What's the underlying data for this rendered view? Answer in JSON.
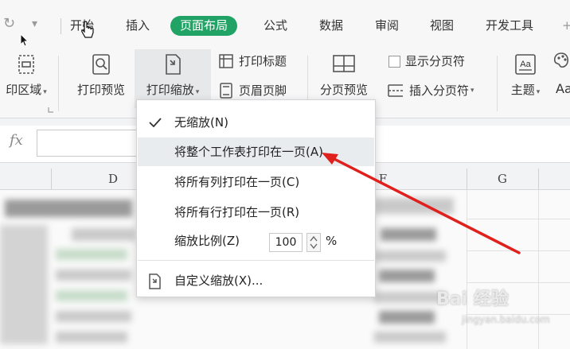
{
  "menu_tabs": [
    {
      "label": "开始"
    },
    {
      "label": "插入"
    },
    {
      "label": "页面布局",
      "active": true
    },
    {
      "label": "公式"
    },
    {
      "label": "数据"
    },
    {
      "label": "审阅"
    },
    {
      "label": "视图"
    },
    {
      "label": "开发工具"
    }
  ],
  "accent_color": "#22a366",
  "arrow_color": "#e0201c",
  "ribbon": {
    "print_area": "印区域",
    "print_preview": "打印预览",
    "print_scale": "打印缩放",
    "print_titles": "打印标题",
    "header_footer": "页眉页脚",
    "page_break_preview": "分页预览",
    "show_page_breaks": "显示分页符",
    "insert_page_break": "插入分页符",
    "theme": "主题",
    "font_partial": "Aa"
  },
  "formula_bar": {
    "fx": "fx",
    "value": ""
  },
  "columns": [
    "D",
    "F",
    "G"
  ],
  "dropdown": {
    "items": [
      {
        "label": "无缩放(N)",
        "checked": true
      },
      {
        "label": "将整个工作表打印在一页(A)",
        "highlighted": true
      },
      {
        "label": "将所有列打印在一页(C)"
      },
      {
        "label": "将所有行打印在一页(R)"
      }
    ],
    "scale_label": "缩放比例(Z)",
    "scale_value": "100",
    "scale_unit": "%",
    "custom_label": "自定义缩放(X)..."
  },
  "watermark": {
    "text": "Bai 经验",
    "sub": "jingyan.baidu.com"
  }
}
